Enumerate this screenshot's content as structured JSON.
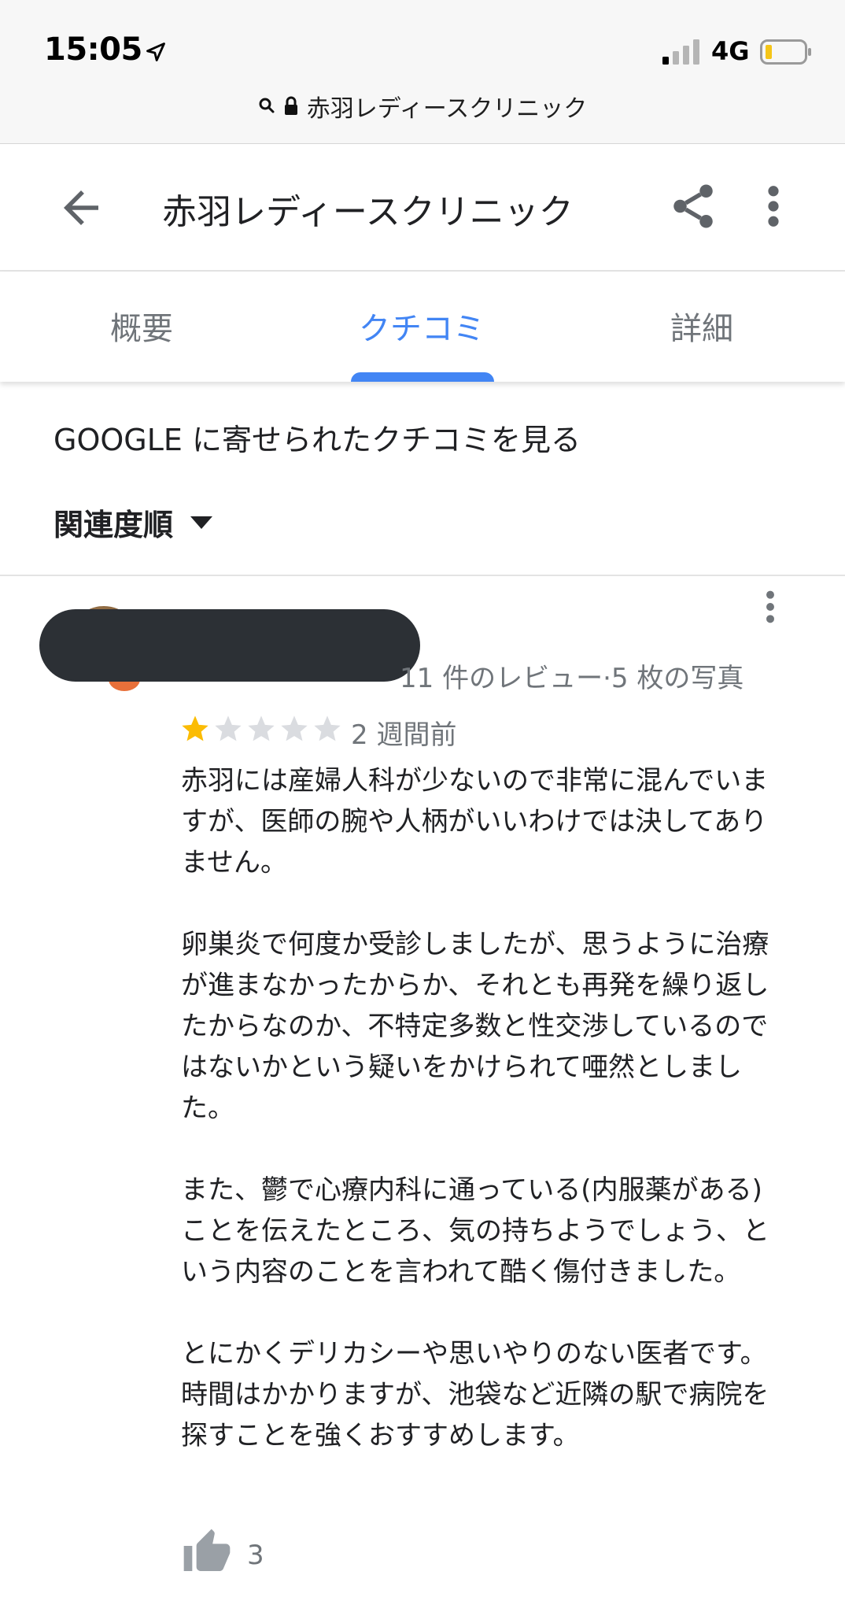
{
  "status_bar": {
    "time": "15:05",
    "network": "4G",
    "url": "赤羽レディースクリニック"
  },
  "app_bar": {
    "title": "赤羽レディースクリニック"
  },
  "tabs": [
    {
      "label": "概要"
    },
    {
      "label": "クチコミ",
      "active": true
    },
    {
      "label": "詳細"
    }
  ],
  "reviews_section": {
    "see_reviews": "GOOGLE に寄せられたクチコミを見る",
    "sort_label": "関連度順"
  },
  "review": {
    "meta": "11 件のレビュー·5 枚の写真",
    "rating": 1,
    "max_rating": 5,
    "time": "2 週間前",
    "paragraphs": [
      "赤羽には産婦人科が少ないので非常に混んでいますが、医師の腕や人柄がいいわけでは決してありません。",
      "卵巣炎で何度か受診しましたが、思うように治療が進まなかったからか、それとも再発を繰り返したからなのか、不特定多数と性交渉しているのではないかという疑いをかけられて唖然としました。",
      "また、鬱で心療内科に通っている(内服薬がある)ことを伝えたところ、気の持ちようでしょう、という内容のことを言われて酷く傷付きました。",
      "とにかくデリカシーや思いやりのない医者です。時間はかかりますが、池袋など近隣の駅で病院を探すことを強くおすすめします。"
    ],
    "likes": "3"
  },
  "colors": {
    "accent": "#4285f4",
    "star_filled": "#fbbc04",
    "star_empty": "#dadce0",
    "secondary_text": "#70757a"
  }
}
